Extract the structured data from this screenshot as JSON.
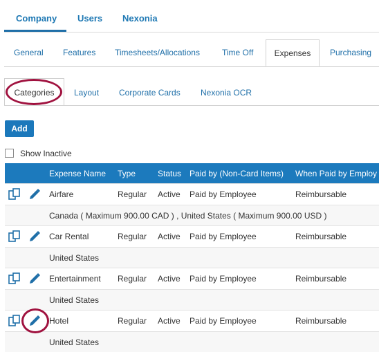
{
  "top_nav": {
    "items": [
      "Company",
      "Users",
      "Nexonia"
    ],
    "active": "Company"
  },
  "settings_tabs": [
    "General",
    "Features",
    "Timesheets/Allocations",
    "Time Off",
    "Expenses",
    "Purchasing"
  ],
  "settings_active": "Expenses",
  "expense_tabs": [
    "Categories",
    "Layout",
    "Corporate Cards",
    "Nexonia OCR"
  ],
  "expense_active": "Categories",
  "add_button": "Add",
  "show_inactive": {
    "label": "Show Inactive",
    "checked": false
  },
  "table": {
    "columns": [
      "Expense Name",
      "Type",
      "Status",
      "Paid by (Non-Card Items)",
      "When Paid by Employ"
    ],
    "rows": [
      {
        "name": "Airfare",
        "type": "Regular",
        "status": "Active",
        "paid_by": "Paid by Employee",
        "when_paid": "Reimbursable",
        "detail": "Canada ( Maximum 900.00 CAD ) , United States ( Maximum 900.00 USD )"
      },
      {
        "name": "Car Rental",
        "type": "Regular",
        "status": "Active",
        "paid_by": "Paid by Employee",
        "when_paid": "Reimbursable",
        "detail": "United States"
      },
      {
        "name": "Entertainment",
        "type": "Regular",
        "status": "Active",
        "paid_by": "Paid by Employee",
        "when_paid": "Reimbursable",
        "detail": "United States"
      },
      {
        "name": "Hotel",
        "type": "Regular",
        "status": "Active",
        "paid_by": "Paid by Employee",
        "when_paid": "Reimbursable",
        "detail": "United States"
      }
    ]
  },
  "colors": {
    "accent": "#1c7abd",
    "highlight_circle": "#a0123f"
  }
}
